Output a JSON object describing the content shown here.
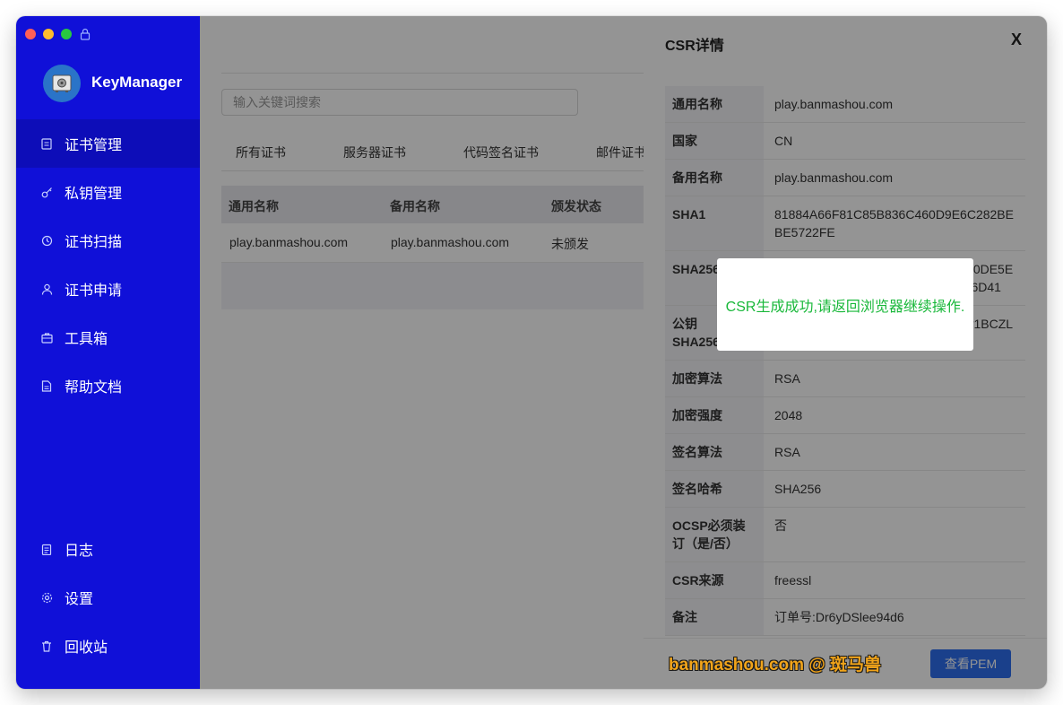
{
  "app": {
    "name": "KeyManager"
  },
  "sidebar": {
    "items": [
      {
        "label": "证书管理",
        "icon": "certificate-icon"
      },
      {
        "label": "私钥管理",
        "icon": "key-icon"
      },
      {
        "label": "证书扫描",
        "icon": "scan-icon"
      },
      {
        "label": "证书申请",
        "icon": "user-icon"
      },
      {
        "label": "工具箱",
        "icon": "toolbox-icon"
      },
      {
        "label": "帮助文档",
        "icon": "document-icon"
      }
    ],
    "bottom": [
      {
        "label": "日志",
        "icon": "log-icon"
      },
      {
        "label": "设置",
        "icon": "gear-icon"
      },
      {
        "label": "回收站",
        "icon": "trash-icon"
      }
    ]
  },
  "main": {
    "search_placeholder": "输入关键词搜索",
    "tabs": [
      "所有证书",
      "服务器证书",
      "代码签名证书",
      "邮件证书"
    ],
    "columns": [
      "通用名称",
      "备用名称",
      "颁发状态"
    ],
    "rows": [
      {
        "common_name": "play.banmashou.com",
        "alt_name": "play.banmashou.com",
        "status": "未颁发"
      }
    ]
  },
  "drawer": {
    "title": "CSR详情",
    "close": "X",
    "fields": [
      {
        "label": "通用名称",
        "value": "play.banmashou.com"
      },
      {
        "label": "国家",
        "value": "CN"
      },
      {
        "label": "备用名称",
        "value": "play.banmashou.com"
      },
      {
        "label": "SHA1",
        "value": "81884A66F81C85B836C460D9E6C282BEBE5722FE"
      },
      {
        "label": "SHA256",
        "value": "E6CAD4F0E730AC27849439EDB30DE5ECA8FFA737136DC1D6A7167FB096D41"
      },
      {
        "label": "公钥SHA256PIN",
        "value": "HswtTRSFLn7k9a/W6lYbLnWWfoly1BCZLZ2pEsMP0hXng="
      },
      {
        "label": "加密算法",
        "value": "RSA"
      },
      {
        "label": "加密强度",
        "value": "2048"
      },
      {
        "label": "签名算法",
        "value": "RSA"
      },
      {
        "label": "签名哈希",
        "value": "SHA256"
      },
      {
        "label": "OCSP必须装订（是/否）",
        "value": "否"
      },
      {
        "label": "CSR来源",
        "value": "freessl"
      },
      {
        "label": "备注",
        "value": "订单号:Dr6yDSlee94d6"
      }
    ],
    "view_pem": "查看PEM"
  },
  "toast": {
    "message": "CSR生成成功,请返回浏览器继续操作."
  },
  "watermark": "banmashou.com @ 斑马兽",
  "colors": {
    "sidebar": "#1010d8",
    "accent": "#2d6ff0",
    "toast_text": "#19b83a"
  }
}
